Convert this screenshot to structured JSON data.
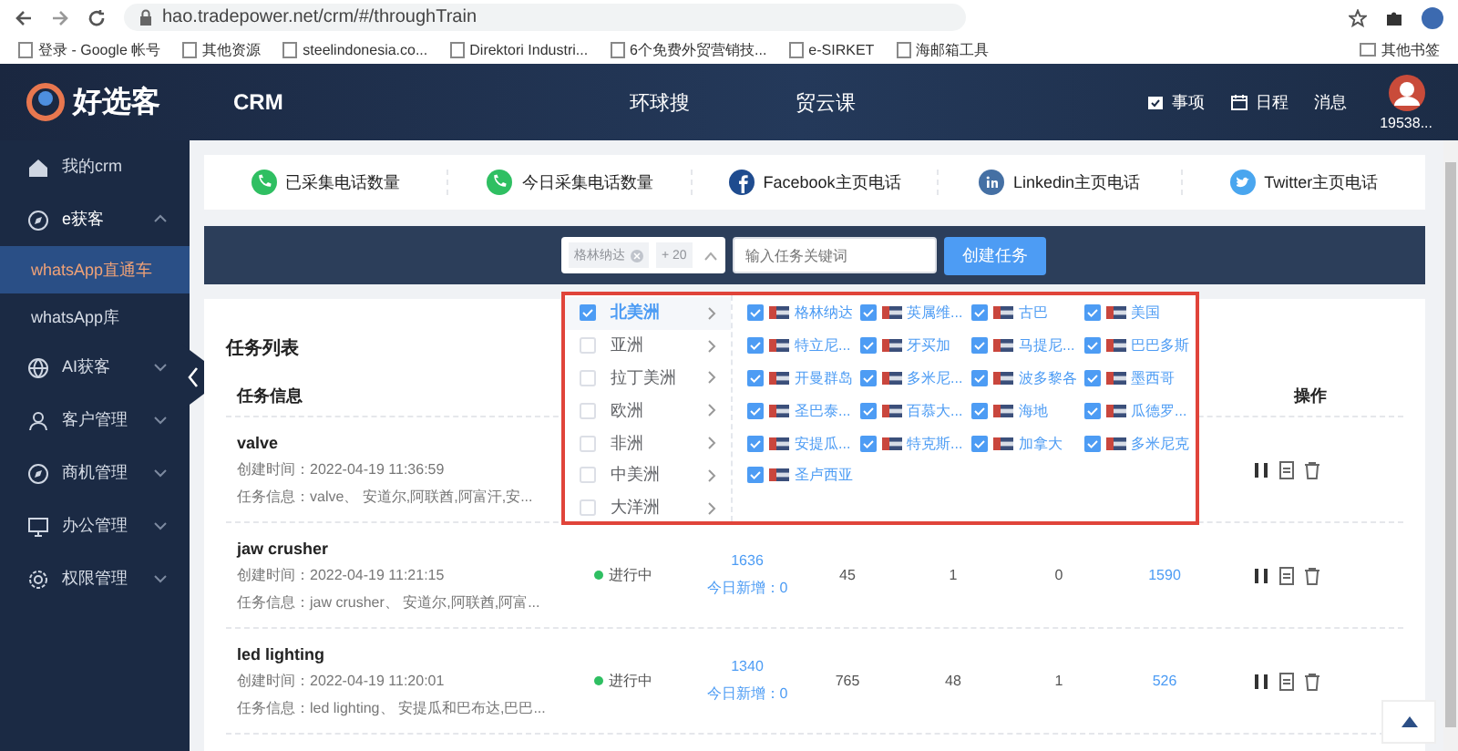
{
  "browser": {
    "url": "hao.tradepower.net/crm/#/throughTrain",
    "bookmarks": [
      "登录 - Google 帐号",
      "其他资源",
      "steelindonesia.co...",
      "Direktori Industri...",
      "6个免费外贸营销技...",
      "e-SIRKET",
      "海邮箱工具"
    ],
    "other_bookmarks": "其他书签"
  },
  "header": {
    "logo": "好选客",
    "nav": [
      {
        "label": "CRM"
      },
      {
        "label": "环球搜"
      },
      {
        "label": "贸云课"
      }
    ],
    "actions": [
      {
        "kind": "todo",
        "label": "事项"
      },
      {
        "kind": "calendar",
        "label": "日程"
      },
      {
        "kind": "plain",
        "label": "消息"
      }
    ],
    "user": "19538..."
  },
  "sidebar": {
    "items": [
      {
        "label": "我的crm"
      },
      {
        "label": "e获客",
        "expanded": true,
        "children": [
          {
            "label": "whatsApp直通车",
            "selected": true
          },
          {
            "label": "whatsApp库",
            "selected": false
          }
        ]
      },
      {
        "label": "AI获客",
        "expanded": false
      },
      {
        "label": "客户管理",
        "expanded": false
      },
      {
        "label": "商机管理",
        "expanded": false
      },
      {
        "label": "办公管理",
        "expanded": false
      },
      {
        "label": "权限管理",
        "expanded": false
      }
    ]
  },
  "stats": [
    {
      "kind": "phone",
      "label": "已采集电话数量"
    },
    {
      "kind": "phone",
      "label": "今日采集电话数量"
    },
    {
      "kind": "facebook",
      "label": "Facebook主页电话"
    },
    {
      "kind": "linkedin",
      "label": "Linkedin主页电话"
    },
    {
      "kind": "twitter",
      "label": "Twitter主页电话"
    }
  ],
  "filter": {
    "tag": "格林纳达",
    "more": "+ 20",
    "keyword_placeholder": "输入任务关键词",
    "create_button": "创建任务"
  },
  "region_dropdown": {
    "continents": [
      {
        "label": "北美洲",
        "checked": true,
        "selected": true
      },
      {
        "label": "亚洲",
        "checked": false,
        "selected": false
      },
      {
        "label": "拉丁美洲",
        "checked": false,
        "selected": false
      },
      {
        "label": "欧洲",
        "checked": false,
        "selected": false
      },
      {
        "label": "非洲",
        "checked": false,
        "selected": false
      },
      {
        "label": "中美洲",
        "checked": false,
        "selected": false
      },
      {
        "label": "大洋洲",
        "checked": false,
        "selected": false
      }
    ],
    "countries": [
      {
        "label": "格林纳达",
        "checked": true
      },
      {
        "label": "英属维...",
        "checked": true
      },
      {
        "label": "古巴",
        "checked": true
      },
      {
        "label": "美国",
        "checked": true
      },
      {
        "label": "特立尼...",
        "checked": true
      },
      {
        "label": "牙买加",
        "checked": true
      },
      {
        "label": "马提尼...",
        "checked": true
      },
      {
        "label": "巴巴多斯",
        "checked": true
      },
      {
        "label": "开曼群岛",
        "checked": true
      },
      {
        "label": "多米尼...",
        "checked": true
      },
      {
        "label": "波多黎各",
        "checked": true
      },
      {
        "label": "墨西哥",
        "checked": true
      },
      {
        "label": "圣巴泰...",
        "checked": true
      },
      {
        "label": "百慕大...",
        "checked": true
      },
      {
        "label": "海地",
        "checked": true
      },
      {
        "label": "瓜德罗...",
        "checked": true
      },
      {
        "label": "安提瓜...",
        "checked": true
      },
      {
        "label": "特克斯...",
        "checked": true
      },
      {
        "label": "加拿大",
        "checked": true
      },
      {
        "label": "多米尼克",
        "checked": true
      },
      {
        "label": "圣卢西亚",
        "checked": true
      }
    ]
  },
  "task_list": {
    "title": "任务列表",
    "columns": [
      {
        "label": "任务信息"
      },
      {
        "label": "操作"
      }
    ],
    "rows": [
      {
        "name": "valve",
        "created": "创建时间：2022-04-19 11:36:59",
        "info": "任务信息：valve、 安道尔,阿联酋,阿富汗,安..."
      },
      {
        "name": "jaw crusher",
        "created": "创建时间：2022-04-19 11:21:15",
        "info": "任务信息：jaw crusher、 安道尔,阿联酋,阿富...",
        "status": "进行中",
        "total": "1636",
        "today": "今日新增：0",
        "column_3": "45",
        "column_4": "1",
        "column_5": "0",
        "column_6": "1590"
      },
      {
        "name": "led lighting",
        "created": "创建时间：2022-04-19 11:20:01",
        "info": "任务信息：led lighting、 安提瓜和巴布达,巴巴...",
        "status": "进行中",
        "total": "1340",
        "today": "今日新增：0",
        "column_3": "765",
        "column_4": "48",
        "column_5": "1",
        "column_6": "526"
      }
    ]
  }
}
